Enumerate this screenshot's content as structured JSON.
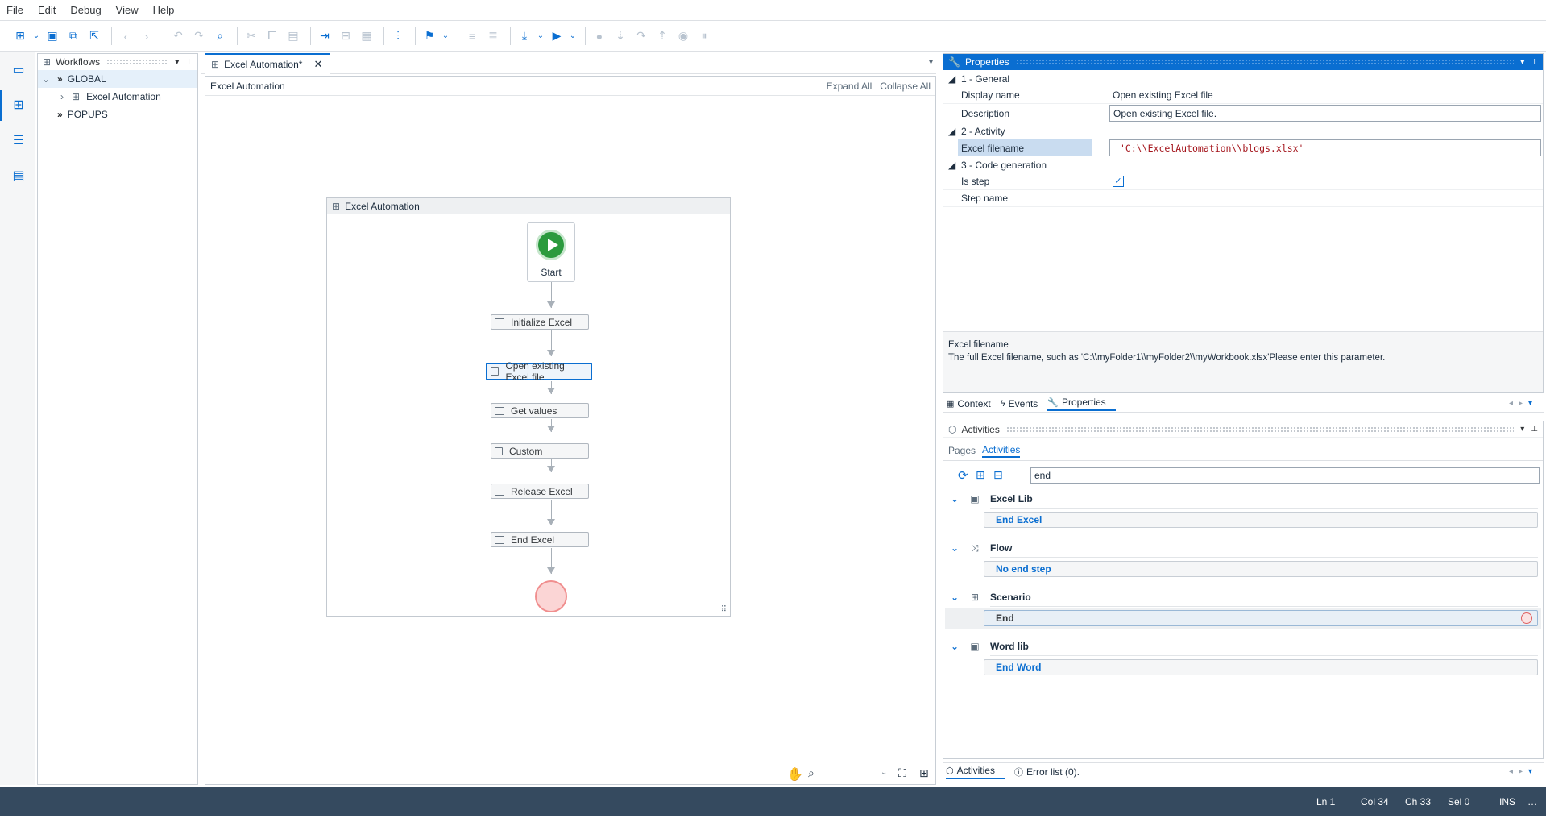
{
  "menu": [
    "File",
    "Edit",
    "Debug",
    "View",
    "Help"
  ],
  "workflows": {
    "title": "Workflows",
    "items": [
      {
        "label": "GLOBAL"
      },
      {
        "label": "Excel Automation"
      },
      {
        "label": "POPUPS"
      }
    ]
  },
  "document": {
    "tab_label": "Excel Automation*",
    "header_title": "Excel Automation",
    "expand_all": "Expand All",
    "collapse_all": "Collapse All",
    "workflow_title": "Excel Automation",
    "start_label": "Start",
    "nodes": [
      "Initialize Excel",
      "Open existing Excel file",
      "Get values",
      "Custom",
      "Release Excel",
      "End Excel"
    ]
  },
  "properties": {
    "title": "Properties",
    "cat_general": "1 - General",
    "display_name_key": "Display name",
    "display_name_val": "Open existing Excel file",
    "description_key": "Description",
    "description_val": "Open existing Excel file.",
    "cat_activity": "2 - Activity",
    "excel_filename_key": "Excel filename",
    "excel_filename_val": "'C:\\\\ExcelAutomation\\\\blogs.xlsx'",
    "cat_codegen": "3 - Code generation",
    "is_step_key": "Is step",
    "step_name_key": "Step name",
    "desc_title": "Excel filename",
    "desc_text": "The full Excel filename, such as  'C:\\\\myFolder1\\\\myFolder2\\\\myWorkbook.xlsx'Please enter this parameter."
  },
  "mid_tabs": {
    "context": "Context",
    "events": "Events",
    "properties": "Properties"
  },
  "activities": {
    "title": "Activities",
    "tab_pages": "Pages",
    "tab_activities": "Activities",
    "search_value": "end",
    "groups": [
      {
        "name": "Excel Lib",
        "item": "End Excel"
      },
      {
        "name": "Flow",
        "item": "No end step"
      },
      {
        "name": "Scenario",
        "item": "End"
      },
      {
        "name": "Word lib",
        "item": "End Word"
      }
    ]
  },
  "bottom_tabs": {
    "activities": "Activities",
    "errors": "Error list (0)."
  },
  "status": {
    "ln": "Ln 1",
    "col": "Col 34",
    "ch": "Ch 33",
    "sel": "Sel 0",
    "ins": "INS"
  },
  "colors": {
    "accent": "#0a6ed1",
    "start": "#2b9a3e",
    "end": "#f4c4c4",
    "statusbar": "#354a5f"
  }
}
